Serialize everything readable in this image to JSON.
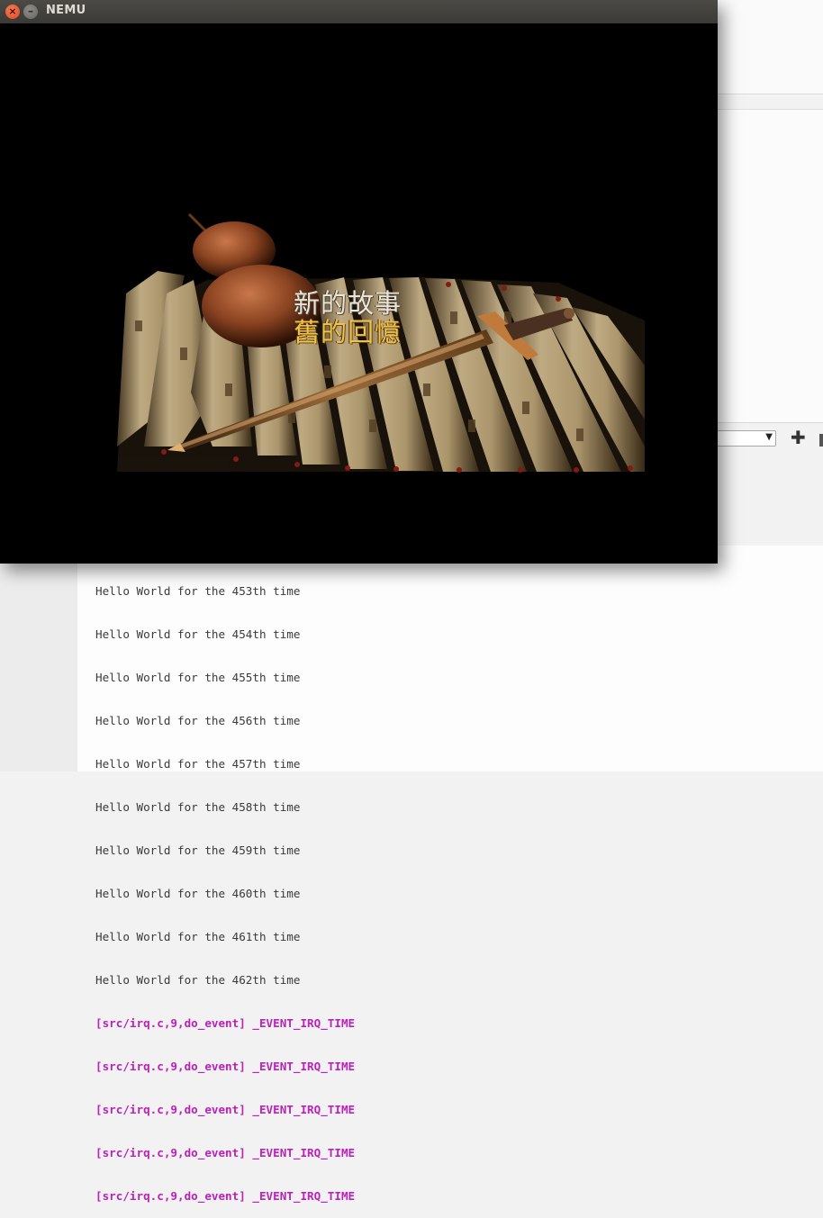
{
  "window": {
    "title": "NEMU"
  },
  "game": {
    "caption_line1": "新的故事",
    "caption_line2": "舊的回憶"
  },
  "background_app": {
    "plus_label": "✚",
    "dropdown_arrow": "▼"
  },
  "terminal": {
    "lines": [
      "Hello World for the 453th time",
      "Hello World for the 454th time",
      "Hello World for the 455th time",
      "Hello World for the 456th time",
      "Hello World for the 457th time",
      "Hello World for the 458th time",
      "Hello World for the 459th time",
      "Hello World for the 460th time",
      "Hello World for the 461th time",
      "Hello World for the 462th time",
      "[src/irq.c,9,do_event] _EVENT_IRQ_TIME",
      "[src/irq.c,9,do_event] _EVENT_IRQ_TIME",
      "[src/irq.c,9,do_event] _EVENT_IRQ_TIME",
      "[src/irq.c,9,do_event] _EVENT_IRQ_TIME",
      "[src/irq.c,9,do_event] _EVENT_IRQ_TIME"
    ],
    "irq_color": "#bd1fbd"
  },
  "icons": {
    "close": "close-icon",
    "minimize": "minimize-icon"
  }
}
